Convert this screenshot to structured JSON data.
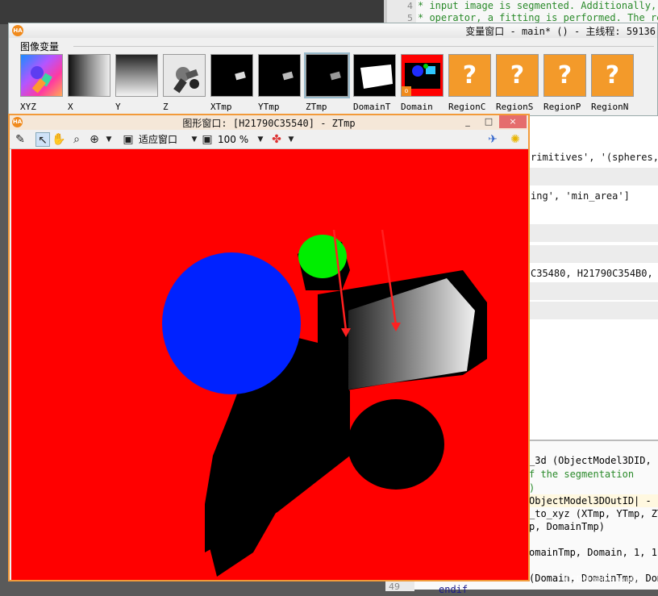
{
  "code_top": {
    "lines": [
      {
        "num": "4",
        "text": "* input image is segmented. Additionally,"
      },
      {
        "num": "5",
        "text": "* operator, a fitting is performed. The re"
      }
    ]
  },
  "var_window": {
    "title": "变量窗口 - main* () - 主线程: 59136",
    "group_label": "图像变量",
    "thumbs": [
      {
        "label": "XYZ"
      },
      {
        "label": "X"
      },
      {
        "label": "Y"
      },
      {
        "label": "Z"
      },
      {
        "label": "XTmp"
      },
      {
        "label": "YTmp"
      },
      {
        "label": "ZTmp"
      },
      {
        "label": "DomainT"
      },
      {
        "label": "Domain"
      },
      {
        "label": "RegionC"
      },
      {
        "label": "RegionS"
      },
      {
        "label": "RegionP"
      },
      {
        "label": "RegionN"
      }
    ],
    "unknown_symbol": "?"
  },
  "gfx_window": {
    "title": "图形窗口: [H21790C35540] - ZTmp",
    "minimize": "_",
    "maximize": "□",
    "close": "×",
    "fit_window_label": "适应窗口",
    "zoom_label": "100 %"
  },
  "code_right": {
    "rows": [
      {
        "text": "rimitives', '(spheres,",
        "gray": false
      },
      {
        "text": "",
        "gray": true
      },
      {
        "text": "ing', 'min_area']",
        "gray": false
      },
      {
        "text": "",
        "gray": true
      },
      {
        "text": "",
        "gray": true
      },
      {
        "text": "C35480, H21790C354B0, H",
        "gray": false
      },
      {
        "text": "",
        "gray": true
      },
      {
        "text": "",
        "gray": true
      }
    ]
  },
  "code_bottom": {
    "lines": [
      {
        "text": "_3d (ObjectModel3DID,",
        "color": "#111"
      },
      {
        "text": "f the segmentation",
        "color": "#2a8a2a"
      },
      {
        "text": ")",
        "color": "#2a8a2a"
      },
      {
        "text": "ObjectModel3DOutID| - 1",
        "color": "#111"
      },
      {
        "text": "_to_xyz (XTmp, YTmp, ZT",
        "color": "#111"
      },
      {
        "text": "p, DomainTmp)",
        "color": "#111"
      },
      {
        "text": "",
        "color": "#111"
      },
      {
        "text": "omainTmp, Domain, 1, 1)",
        "color": "#111"
      },
      {
        "text": "",
        "color": "#111"
      },
      {
        "text": "(Domain, DomainTmp, Dom",
        "color": "#111"
      }
    ],
    "line_num": "49",
    "endif": "endif"
  },
  "watermark": "CSDN @Frankalin"
}
